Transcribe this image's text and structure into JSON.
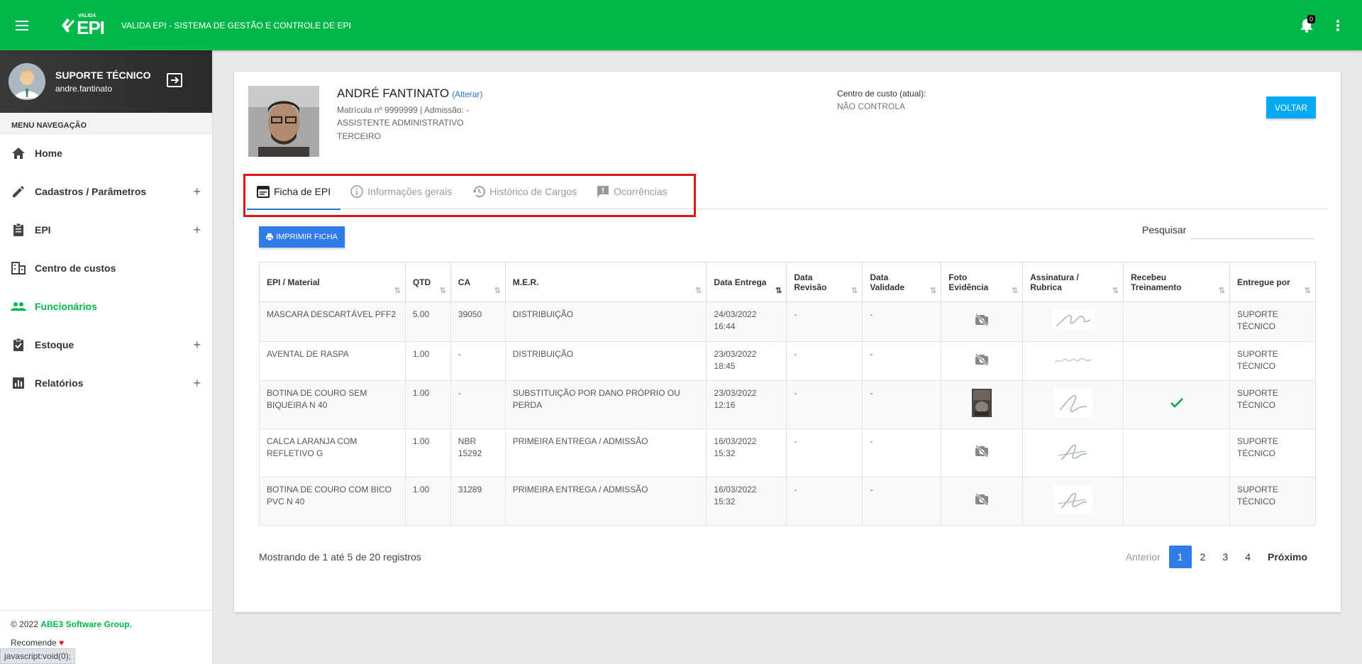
{
  "topbar": {
    "logo_small": "VALIDA",
    "logo_big": "EPI",
    "title": "VALIDA EPI - SISTEMA DE GESTÃO E CONTROLE DE EPI",
    "notification_count": "0"
  },
  "sidebar": {
    "user_name": "SUPORTE TÉCNICO",
    "user_login": "andre.fantinato",
    "nav_header": "MENU NAVEGAÇÃO",
    "items": [
      {
        "label": "Home",
        "icon": "home-icon",
        "expandable": false,
        "active": false
      },
      {
        "label": "Cadastros / Parâmetros",
        "icon": "pencil-icon",
        "expandable": true,
        "active": false
      },
      {
        "label": "EPI",
        "icon": "clipboard-icon",
        "expandable": true,
        "active": false
      },
      {
        "label": "Centro de custos",
        "icon": "building-icon",
        "expandable": false,
        "active": false
      },
      {
        "label": "Funcionários",
        "icon": "people-icon",
        "expandable": false,
        "active": true
      },
      {
        "label": "Estoque",
        "icon": "clipboard-check-icon",
        "expandable": true,
        "active": false
      },
      {
        "label": "Relatórios",
        "icon": "bar-chart-icon",
        "expandable": true,
        "active": false
      }
    ],
    "footer_copyright": "© 2022",
    "footer_brand": "ABE3 Software Group.",
    "footer_recommend": "Recomende",
    "status_url": "javascript:void(0);"
  },
  "employee": {
    "name": "ANDRÉ FANTINATO",
    "alter_link": "(Alterar)",
    "line1": "Matrícula nº 9999999 | Admissão: -",
    "line2": "ASSISTENTE ADMINISTRATIVO",
    "line3": "TERCEIRO",
    "cost_center_label": "Centro de custo (atual):",
    "cost_center_value": "NÃO CONTROLA",
    "back_button": "VOLTAR"
  },
  "tabs": [
    {
      "label": "Ficha de EPI",
      "icon": "calendar-icon",
      "active": true
    },
    {
      "label": "Informações gerais",
      "icon": "info-icon",
      "active": false
    },
    {
      "label": "Histórico de Cargos",
      "icon": "history-icon",
      "active": false
    },
    {
      "label": "Ocorrências",
      "icon": "feedback-icon",
      "active": false
    }
  ],
  "toolbar": {
    "print_button": "IMPRIMIR FICHA",
    "search_label": "Pesquisar",
    "search_value": ""
  },
  "table": {
    "headers": [
      "EPI / Material",
      "QTD",
      "CA",
      "M.E.R.",
      "Data Entrega",
      "Data Revisão",
      "Data Validade",
      "Foto Evidência",
      "Assinatura / Rubrica",
      "Recebeu Treinamento",
      "Entregue por"
    ],
    "rows": [
      {
        "material": "MASCARA DESCARTÁVEL PFF2",
        "qtd": "5.00",
        "ca": "39050",
        "mer": "DISTRIBUIÇÃO",
        "entrega": "24/03/2022 16:44",
        "revisao": "-",
        "validade": "-",
        "foto": "no-photo-icon",
        "treinamento": false,
        "entregue_por": "SUPORTE TÉCNICO"
      },
      {
        "material": "AVENTAL DE RASPA",
        "qtd": "1.00",
        "ca": "-",
        "mer": "DISTRIBUIÇÃO",
        "entrega": "23/03/2022 18:45",
        "revisao": "-",
        "validade": "-",
        "foto": "no-photo-icon",
        "treinamento": false,
        "entregue_por": "SUPORTE TÉCNICO"
      },
      {
        "material": "BOTINA DE COURO SEM BIQUEIRA N 40",
        "qtd": "1.00",
        "ca": "-",
        "mer": "SUBSTITUIÇÃO POR DANO PRÓPRIO OU PERDA",
        "entrega": "23/03/2022 12:16",
        "revisao": "-",
        "validade": "-",
        "foto": "photo-thumbnail",
        "treinamento": true,
        "entregue_por": "SUPORTE TÉCNICO"
      },
      {
        "material": "CALCA LARANJA COM REFLETIVO G",
        "qtd": "1.00",
        "ca": "NBR 15292",
        "mer": "PRIMEIRA ENTREGA / ADMISSÃO",
        "entrega": "16/03/2022 15:32",
        "revisao": "-",
        "validade": "-",
        "foto": "no-photo-icon",
        "treinamento": false,
        "entregue_por": "SUPORTE TÉCNICO"
      },
      {
        "material": "BOTINA DE COURO COM BICO PVC N 40",
        "qtd": "1.00",
        "ca": "31289",
        "mer": "PRIMEIRA ENTREGA / ADMISSÃO",
        "entrega": "16/03/2022 15:32",
        "revisao": "-",
        "validade": "-",
        "foto": "no-photo-icon",
        "treinamento": false,
        "entregue_por": "SUPORTE TÉCNICO"
      }
    ]
  },
  "pagination": {
    "info": "Mostrando de 1 até 5 de 20 registros",
    "previous": "Anterior",
    "pages": [
      "1",
      "2",
      "3",
      "4"
    ],
    "current": "1",
    "next": "Próximo"
  },
  "colors": {
    "brand_green": "#00b84a",
    "primary_blue": "#2f7be8",
    "back_button_blue": "#03a9f4",
    "highlight_red": "#e0141b"
  }
}
